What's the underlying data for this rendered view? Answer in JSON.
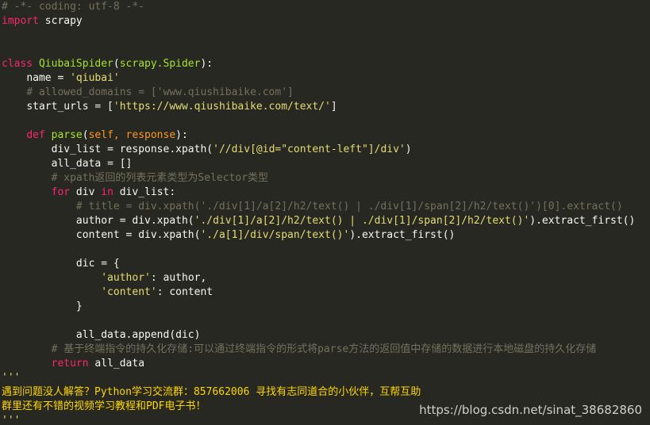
{
  "code_lines": [
    {
      "indent": "",
      "segments": [
        {
          "t": "cmt",
          "v": "# -*- coding: utf-8 -*-"
        }
      ]
    },
    {
      "indent": "",
      "segments": [
        {
          "t": "kw",
          "v": "import"
        },
        {
          "t": "txt",
          "v": " scrapy"
        }
      ]
    },
    {
      "indent": "",
      "segments": []
    },
    {
      "indent": "",
      "segments": []
    },
    {
      "indent": "",
      "segments": [
        {
          "t": "kw",
          "v": "class"
        },
        {
          "t": "txt",
          "v": " "
        },
        {
          "t": "fn",
          "v": "QiubaiSpider"
        },
        {
          "t": "txt",
          "v": "("
        },
        {
          "t": "fn",
          "v": "scrapy.Spider"
        },
        {
          "t": "txt",
          "v": "):"
        }
      ]
    },
    {
      "indent": "    ",
      "segments": [
        {
          "t": "txt",
          "v": "name = "
        },
        {
          "t": "str",
          "v": "'qiubai'"
        }
      ]
    },
    {
      "indent": "    ",
      "segments": [
        {
          "t": "cmt",
          "v": "# allowed_domains = ['www.qiushibaike.com']"
        }
      ]
    },
    {
      "indent": "    ",
      "segments": [
        {
          "t": "txt",
          "v": "start_urls = ["
        },
        {
          "t": "str",
          "v": "'https://www.qiushibaike.com/text/'"
        },
        {
          "t": "txt",
          "v": "]"
        }
      ]
    },
    {
      "indent": "",
      "segments": []
    },
    {
      "indent": "    ",
      "segments": [
        {
          "t": "kw",
          "v": "def"
        },
        {
          "t": "txt",
          "v": " "
        },
        {
          "t": "fn",
          "v": "parse"
        },
        {
          "t": "txt",
          "v": "("
        },
        {
          "t": "param",
          "v": "self, response"
        },
        {
          "t": "txt",
          "v": "):"
        }
      ]
    },
    {
      "indent": "        ",
      "segments": [
        {
          "t": "txt",
          "v": "div_list = response.xpath("
        },
        {
          "t": "str",
          "v": "'//div[@id=\"content-left\"]/div'"
        },
        {
          "t": "txt",
          "v": ")"
        }
      ]
    },
    {
      "indent": "        ",
      "segments": [
        {
          "t": "txt",
          "v": "all_data = []"
        }
      ]
    },
    {
      "indent": "        ",
      "segments": [
        {
          "t": "cmt",
          "v": "# xpath返回的列表元素类型为Selector类型"
        }
      ]
    },
    {
      "indent": "        ",
      "segments": [
        {
          "t": "kw",
          "v": "for"
        },
        {
          "t": "txt",
          "v": " div "
        },
        {
          "t": "kw",
          "v": "in"
        },
        {
          "t": "txt",
          "v": " div_list:"
        }
      ]
    },
    {
      "indent": "            ",
      "segments": [
        {
          "t": "cmt",
          "v": "# title = div.xpath('./div[1]/a[2]/h2/text() | ./div[1]/span[2]/h2/text()')[0].extract()"
        }
      ]
    },
    {
      "indent": "            ",
      "segments": [
        {
          "t": "txt",
          "v": "author = div.xpath("
        },
        {
          "t": "str",
          "v": "'./div[1]/a[2]/h2/text() | ./div[1]/span[2]/h2/text()'"
        },
        {
          "t": "txt",
          "v": ").extract_first()"
        }
      ]
    },
    {
      "indent": "            ",
      "segments": [
        {
          "t": "txt",
          "v": "content = div.xpath("
        },
        {
          "t": "str",
          "v": "'./a[1]/div/span/text()'"
        },
        {
          "t": "txt",
          "v": ").extract_first()"
        }
      ]
    },
    {
      "indent": "",
      "segments": []
    },
    {
      "indent": "            ",
      "segments": [
        {
          "t": "txt",
          "v": "dic = {"
        }
      ]
    },
    {
      "indent": "                ",
      "segments": [
        {
          "t": "str",
          "v": "'author'"
        },
        {
          "t": "txt",
          "v": ": author,"
        }
      ]
    },
    {
      "indent": "                ",
      "segments": [
        {
          "t": "str",
          "v": "'content'"
        },
        {
          "t": "txt",
          "v": ": content"
        }
      ]
    },
    {
      "indent": "            ",
      "segments": [
        {
          "t": "txt",
          "v": "}"
        }
      ]
    },
    {
      "indent": "",
      "segments": []
    },
    {
      "indent": "            ",
      "segments": [
        {
          "t": "txt",
          "v": "all_data.append(dic)"
        }
      ]
    },
    {
      "indent": "        ",
      "segments": [
        {
          "t": "cmt",
          "v": "# 基于终端指令的持久化存储:可以通过终端指令的形式将parse方法的返回值中存储的数据进行本地磁盘的持久化存储"
        }
      ]
    },
    {
      "indent": "        ",
      "segments": [
        {
          "t": "kw",
          "v": "return"
        },
        {
          "t": "txt",
          "v": " all_data"
        }
      ]
    },
    {
      "indent": "",
      "segments": [
        {
          "t": "str",
          "v": "'''"
        }
      ]
    },
    {
      "indent": "",
      "segments": [
        {
          "t": "yellow",
          "v": "遇到问题没人解答？Python学习交流群：857662006 寻找有志同道合的小伙伴，互帮互助"
        }
      ]
    },
    {
      "indent": "",
      "segments": [
        {
          "t": "yellow",
          "v": "群里还有不错的视频学习教程和PDF电子书！"
        }
      ]
    },
    {
      "indent": "",
      "segments": [
        {
          "t": "str",
          "v": "'''"
        }
      ]
    }
  ],
  "watermark": "https://blog.csdn.net/sinat_38682860",
  "colors": {
    "background": "#272822",
    "comment": "#75715e",
    "keyword": "#f92672",
    "function": "#a6e22e",
    "string": "#e6db74",
    "parameter": "#fd971f",
    "text": "#f8f8f2"
  }
}
